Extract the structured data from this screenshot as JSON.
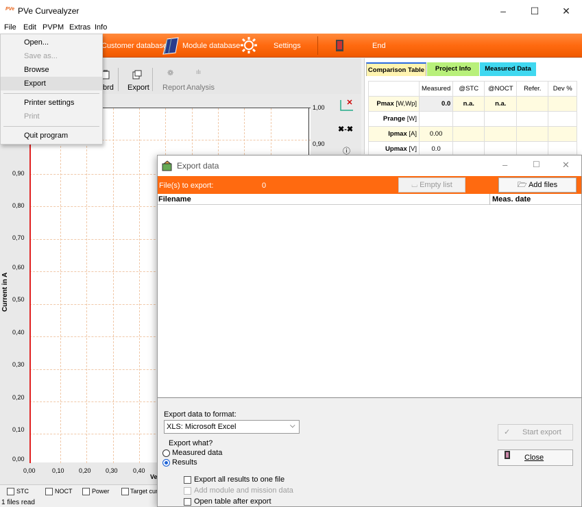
{
  "window": {
    "logo": "PVe",
    "title": "PVe Curvealyzer",
    "min": "–",
    "max": "☐",
    "close": "✕"
  },
  "menubar": [
    "File",
    "Edit",
    "PVPM",
    "Extras",
    "Info"
  ],
  "file_menu": {
    "open": "Open...",
    "save_as": "Save as...",
    "browse": "Browse",
    "export": "Export",
    "printer_settings": "Printer settings",
    "print": "Print",
    "quit": "Quit program"
  },
  "orange_toolbar": {
    "customer_db": "Customer database",
    "module_db": "Module database",
    "settings": "Settings",
    "end": "End"
  },
  "left_toolbar": {
    "clipboard": "brd",
    "export": "Export",
    "report": "Report",
    "analysis": "Analysis"
  },
  "chart_data": {
    "type": "line",
    "ylabel": "Current in A",
    "xlabel": "Ve",
    "y_ticks": [
      "0,00",
      "0,10",
      "0,20",
      "0,30",
      "0,40",
      "0,50",
      "0,60",
      "0,70",
      "0,80",
      "0,90"
    ],
    "x_ticks": [
      "0,00",
      "0,10",
      "0,20",
      "0,30",
      "0,40"
    ],
    "right_y_ticks": [
      "1,00",
      "0,90"
    ],
    "ylim": [
      0,
      1.0
    ],
    "series": []
  },
  "chart_checks": [
    "STC",
    "NOCT",
    "Power",
    "Target curv"
  ],
  "status": "1 files read",
  "right_tabs": [
    "Comparison Table",
    "Project Info",
    "Measured Data"
  ],
  "comparison_table": {
    "headers": [
      "",
      "Measured",
      "@STC",
      "@NOCT",
      "Refer.",
      "Dev %"
    ],
    "rows": [
      {
        "label": "Pmax",
        "unit": "[W,Wp]",
        "measured": "0.0",
        "stc": "n.a.",
        "noct": "n.a."
      },
      {
        "label": "Prange",
        "unit": "[W]",
        "measured": "",
        "stc": "",
        "noct": ""
      },
      {
        "label": "Ipmax",
        "unit": "[A]",
        "measured": "0.00",
        "stc": "",
        "noct": ""
      },
      {
        "label": "Upmax",
        "unit": "[V]",
        "measured": "0.0",
        "stc": "",
        "noct": ""
      }
    ]
  },
  "dialog": {
    "title": "Export data",
    "files_label": "File(s) to export:",
    "files_count": "0",
    "empty_list": "Empty list",
    "add_files": "Add files",
    "col_filename": "Filename",
    "col_date": "Meas. date",
    "format_label": "Export data to format:",
    "format_value": "XLS: Microsoft Excel",
    "what_label": "Export what?",
    "opt_measured": "Measured data",
    "opt_results": "Results",
    "chk_one_file": "Export all results to one file",
    "chk_module": "Add module and mission data",
    "chk_open_table": "Open table after export",
    "start_export": "Start export",
    "close": "Close"
  }
}
